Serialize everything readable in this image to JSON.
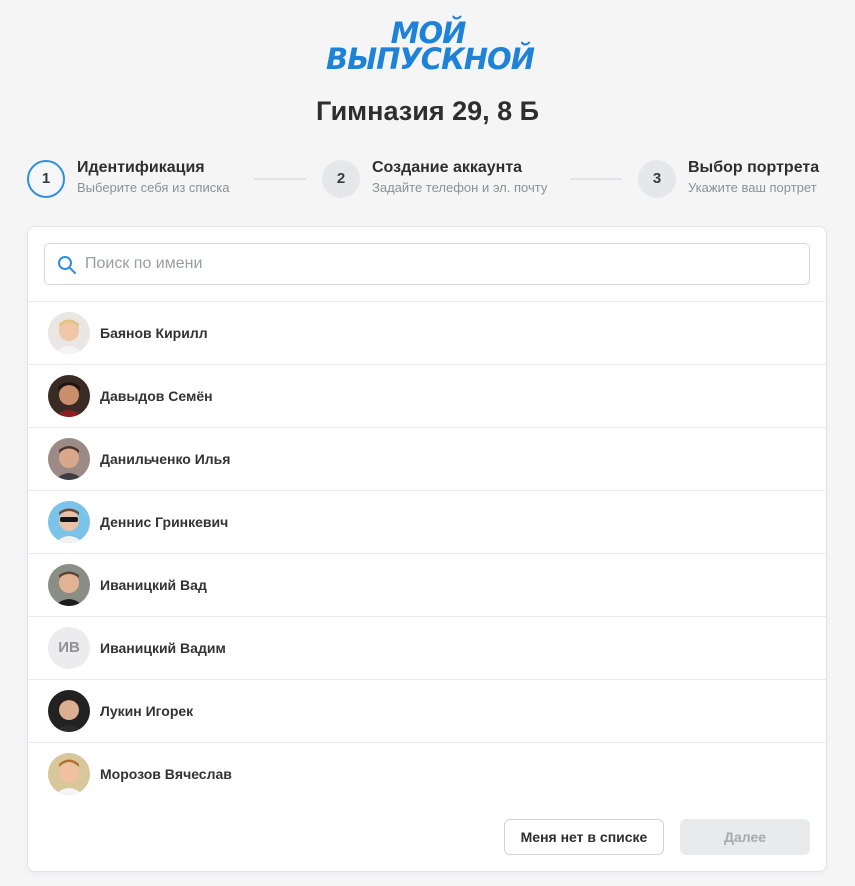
{
  "logo": {
    "line1": "МОЙ",
    "line2": "ВЫПУСКНОЙ"
  },
  "page_title": "Гимназия 29, 8 Б",
  "steps": [
    {
      "number": "1",
      "title": "Идентификация",
      "subtitle": "Выберите себя из списка",
      "active": true
    },
    {
      "number": "2",
      "title": "Создание аккаунта",
      "subtitle": "Задайте телефон и эл. почту",
      "active": false
    },
    {
      "number": "3",
      "title": "Выбор портрета",
      "subtitle": "Укажите ваш портрет",
      "active": false
    }
  ],
  "search": {
    "placeholder": "Поиск по имени",
    "value": ""
  },
  "students": [
    {
      "name": "Баянов Кирилл",
      "avatar": "photo"
    },
    {
      "name": "Давыдов Семён",
      "avatar": "photo"
    },
    {
      "name": "Данильченко Илья",
      "avatar": "photo"
    },
    {
      "name": "Деннис Гринкевич",
      "avatar": "photo"
    },
    {
      "name": "Иваницкий Вад",
      "avatar": "photo"
    },
    {
      "name": "Иваницкий Вадим",
      "avatar": "initials",
      "initials": "ИВ"
    },
    {
      "name": "Лукин Игорек",
      "avatar": "photo"
    },
    {
      "name": "Морозов Вячеслав",
      "avatar": "photo"
    }
  ],
  "footer": {
    "not_in_list_label": "Меня нет в списке",
    "next_label": "Далее"
  },
  "colors": {
    "accent": "#1e83d8",
    "step_active_border": "#2f8ee0",
    "disabled_button": "#e9eaec"
  }
}
